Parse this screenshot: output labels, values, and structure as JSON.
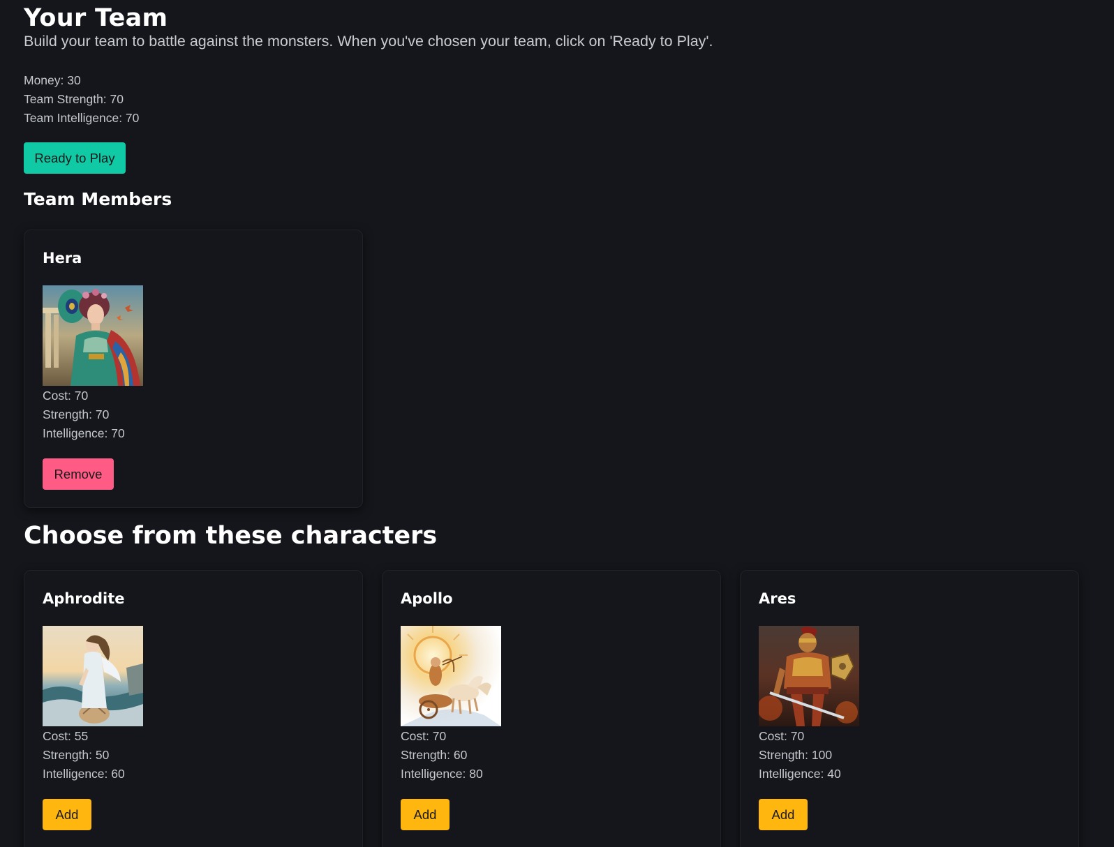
{
  "header": {
    "title": "Your Team",
    "subtitle": "Build your team to battle against the monsters. When you've chosen your team, click on 'Ready to Play'."
  },
  "stats": {
    "money": "Money: 30",
    "strength": "Team Strength: 70",
    "intelligence": "Team Intelligence: 70"
  },
  "ready_button": "Ready to Play",
  "members_heading": "Team Members",
  "members": [
    {
      "name": "Hera",
      "cost": "Cost: 70",
      "strength": "Strength: 70",
      "intelligence": "Intelligence: 70",
      "button": "Remove"
    }
  ],
  "choose_heading": "Choose from these characters",
  "characters": [
    {
      "name": "Aphrodite",
      "cost": "Cost: 55",
      "strength": "Strength: 50",
      "intelligence": "Intelligence: 60",
      "button": "Add"
    },
    {
      "name": "Apollo",
      "cost": "Cost: 70",
      "strength": "Strength: 60",
      "intelligence": "Intelligence: 80",
      "button": "Add"
    },
    {
      "name": "Ares",
      "cost": "Cost: 70",
      "strength": "Strength: 100",
      "intelligence": "Intelligence: 40",
      "button": "Add"
    }
  ],
  "colors": {
    "background": "#14161b",
    "ready_button": "#10c9a5",
    "remove_button": "#ff5b85",
    "add_button": "#ffb70f"
  }
}
